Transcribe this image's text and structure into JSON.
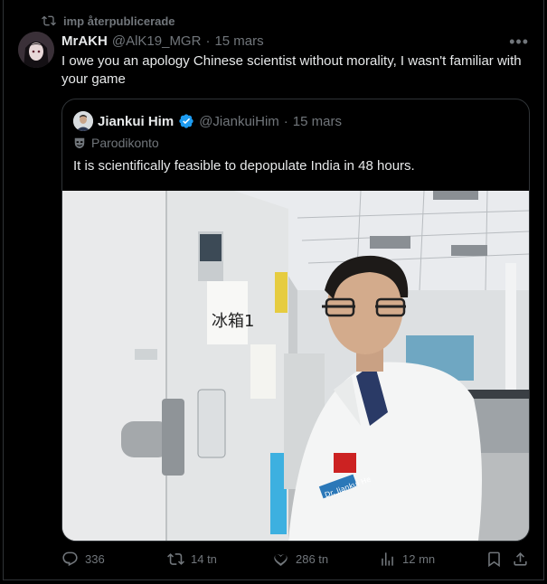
{
  "retweet_context": {
    "label": "imp återpublicerade"
  },
  "tweet": {
    "display_name": "MrAKH",
    "handle": "@AlK19_MGR",
    "separator": "·",
    "date": "15 mars",
    "text": "I owe you an apology Chinese scientist without morality, I wasn't familiar with your game",
    "more_label": "•••"
  },
  "quoted_tweet": {
    "display_name": "Jiankui Him",
    "handle": "@JiankuiHim",
    "separator": "·",
    "date": "15 mars",
    "parody_label": "Parodikonto",
    "text": "It is scientifically feasible to depopulate India in 48 hours.",
    "image": {
      "sign_text": "冰箱1",
      "badge_text": "Dr. Jiankui He"
    }
  },
  "actions": {
    "replies": "336",
    "reposts": "14 tn",
    "likes": "286 tn",
    "views": "12 mn"
  },
  "colors": {
    "background": "#000000",
    "text": "#e7e9ea",
    "muted": "#71767b",
    "border": "#2f3336",
    "verified": "#1d9bf0"
  }
}
